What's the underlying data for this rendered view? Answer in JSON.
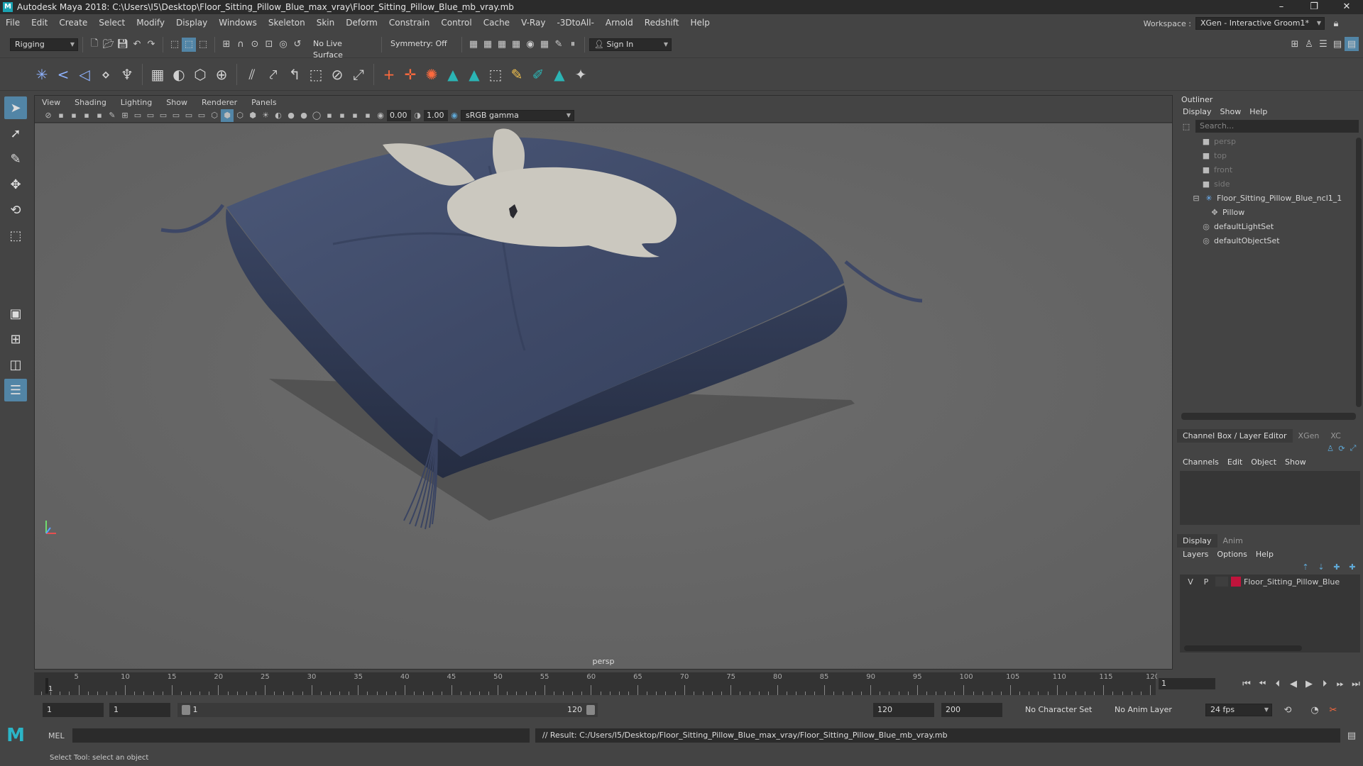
{
  "titlebar": {
    "logo": "M",
    "title": "Autodesk Maya 2018: C:\\Users\\I5\\Desktop\\Floor_Sitting_Pillow_Blue_max_vray\\Floor_Sitting_Pillow_Blue_mb_vray.mb",
    "minimize": "–",
    "restore": "❐",
    "close": "✕"
  },
  "menubar": {
    "items": [
      "File",
      "Edit",
      "Create",
      "Select",
      "Modify",
      "Display",
      "Windows",
      "Skeleton",
      "Skin",
      "Deform",
      "Constrain",
      "Control",
      "Cache",
      "V-Ray",
      "-3DtoAll-",
      "Arnold",
      "Redshift",
      "Help"
    ],
    "workspace_label": "Workspace :",
    "workspace_value": "XGen - Interactive Groom1*"
  },
  "statusline": {
    "mode": "Rigging",
    "live_surface": "No Live Surface",
    "symmetry": "Symmetry: Off",
    "sign_in": "Sign In"
  },
  "viewport": {
    "menu": [
      "View",
      "Shading",
      "Lighting",
      "Show",
      "Renderer",
      "Panels"
    ],
    "exposure": "0.00",
    "gamma": "1.00",
    "color_space": "sRGB gamma",
    "camera_label": "persp"
  },
  "outliner": {
    "title": "Outliner",
    "menu": [
      "Display",
      "Show",
      "Help"
    ],
    "search_placeholder": "Search...",
    "items": [
      {
        "label": "persp",
        "icon": "camera-icon"
      },
      {
        "label": "top",
        "icon": "camera-icon"
      },
      {
        "label": "front",
        "icon": "camera-icon"
      },
      {
        "label": "side",
        "icon": "camera-icon"
      },
      {
        "label": "Floor_Sitting_Pillow_Blue_ncl1_1",
        "icon": "nucleus-icon"
      },
      {
        "label": "Pillow",
        "icon": "mesh-icon"
      },
      {
        "label": "defaultLightSet",
        "icon": "set-icon"
      },
      {
        "label": "defaultObjectSet",
        "icon": "set-icon"
      }
    ]
  },
  "channelbox": {
    "tabs": [
      "Channel Box / Layer Editor",
      "XGen",
      "XC"
    ],
    "menu": [
      "Channels",
      "Edit",
      "Object",
      "Show"
    ],
    "layer_tabs": [
      "Display",
      "Anim"
    ],
    "layer_menu": [
      "Layers",
      "Options",
      "Help"
    ],
    "layer": {
      "v": "V",
      "p": "P",
      "name": "Floor_Sitting_Pillow_Blue",
      "color": "#c0143c"
    }
  },
  "timeline": {
    "ticks": [
      5,
      10,
      15,
      20,
      25,
      30,
      35,
      40,
      45,
      50,
      55,
      60,
      65,
      70,
      75,
      80,
      85,
      90,
      95,
      100,
      105,
      110,
      115,
      120
    ],
    "first_frame": "1",
    "current_frame": "1"
  },
  "range": {
    "start": "1",
    "playback_start": "1",
    "slider_start": "1",
    "slider_end": "120",
    "playback_end": "120",
    "end": "200",
    "character_set": "No Character Set",
    "anim_layer": "No Anim Layer",
    "fps": "24 fps"
  },
  "cmdline": {
    "lang": "MEL",
    "result": "// Result: C:/Users/I5/Desktop/Floor_Sitting_Pillow_Blue_max_vray/Floor_Sitting_Pillow_Blue_mb_vray.mb"
  },
  "helpline": {
    "text": "Select Tool: select an object"
  }
}
